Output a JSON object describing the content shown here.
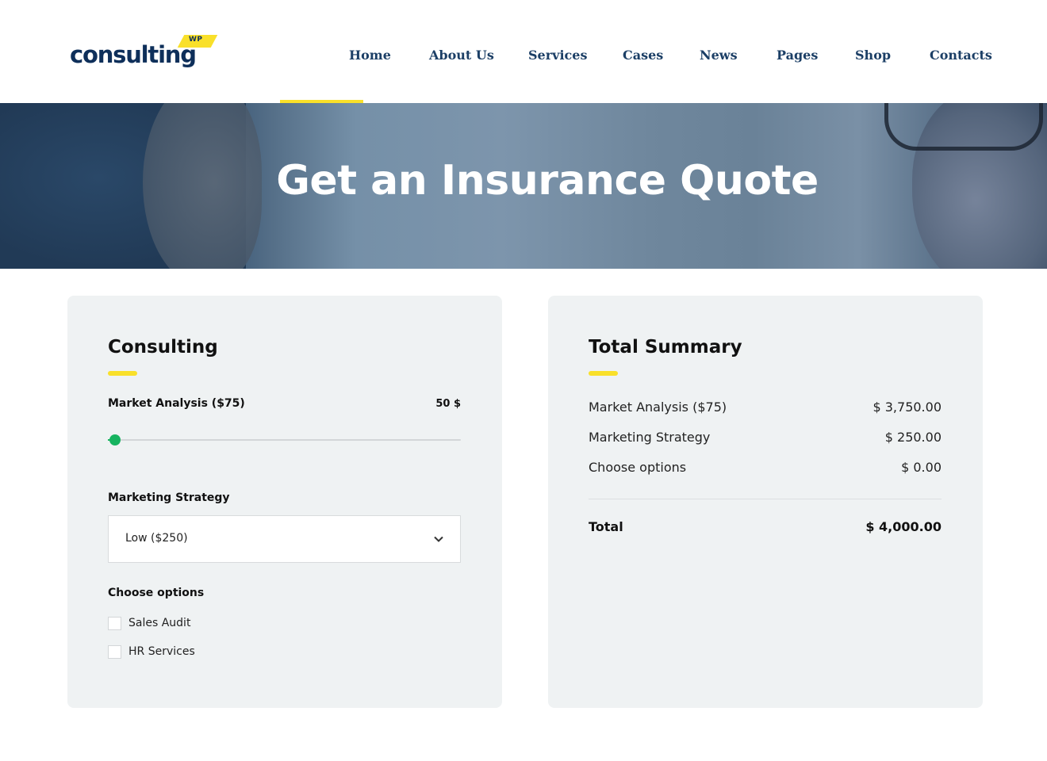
{
  "brand": {
    "name": "consulting",
    "badge": "WP",
    "accent_color": "#f9e02a",
    "primary_color": "#0e2f5a"
  },
  "nav": {
    "items": [
      {
        "label": "Home"
      },
      {
        "label": "About Us"
      },
      {
        "label": "Services"
      },
      {
        "label": "Cases"
      },
      {
        "label": "News"
      },
      {
        "label": "Pages"
      },
      {
        "label": "Shop"
      },
      {
        "label": "Contacts"
      }
    ]
  },
  "hero": {
    "title": "Get an Insurance Quote"
  },
  "calculator": {
    "title": "Consulting",
    "market_analysis": {
      "label": "Market Analysis ($75)",
      "value_text": "50 $",
      "slider_fraction": 0.02,
      "slider_color": "#16b35f"
    },
    "marketing_strategy": {
      "label": "Marketing Strategy",
      "selected": "Low ($250)",
      "icon": "chevron-down-icon"
    },
    "options": {
      "label": "Choose options",
      "items": [
        {
          "label": "Sales Audit",
          "checked": false
        },
        {
          "label": "HR Services",
          "checked": false
        }
      ]
    }
  },
  "summary": {
    "title": "Total Summary",
    "rows": [
      {
        "label": "Market Analysis ($75)",
        "value": "$ 3,750.00"
      },
      {
        "label": "Marketing Strategy",
        "value": "$ 250.00"
      },
      {
        "label": "Choose options",
        "value": "$ 0.00"
      }
    ],
    "total": {
      "label": "Total",
      "value": "$ 4,000.00"
    }
  }
}
